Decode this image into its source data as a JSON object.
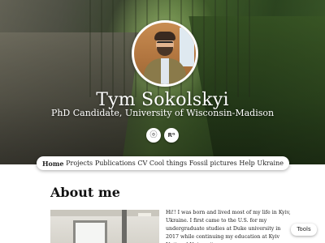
{
  "header": {
    "name": "Tym Sokolskyi",
    "subtitle": "PhD Candidate, University of Wisconsin-Madison"
  },
  "social": [
    {
      "icon": "orcid-icon",
      "glyph": "ⓞ"
    },
    {
      "icon": "researchgate-icon",
      "glyph": "Rᴳ"
    }
  ],
  "nav": {
    "items": [
      {
        "label": "Home"
      },
      {
        "label": "Projects"
      },
      {
        "label": "Publications"
      },
      {
        "label": "CV"
      },
      {
        "label": "Cool things"
      },
      {
        "label": "Fossil pictures"
      },
      {
        "label": "Help Ukraine"
      }
    ]
  },
  "about": {
    "title": "About me",
    "text": "Hi!! I was born and lived most of my life in Kyiv, Ukraine. I first came to the U.S.  for my undergraduate studies at Duke university in 2017 while continuing my education at Kyiv National University."
  },
  "tools": {
    "label": "Tools"
  }
}
